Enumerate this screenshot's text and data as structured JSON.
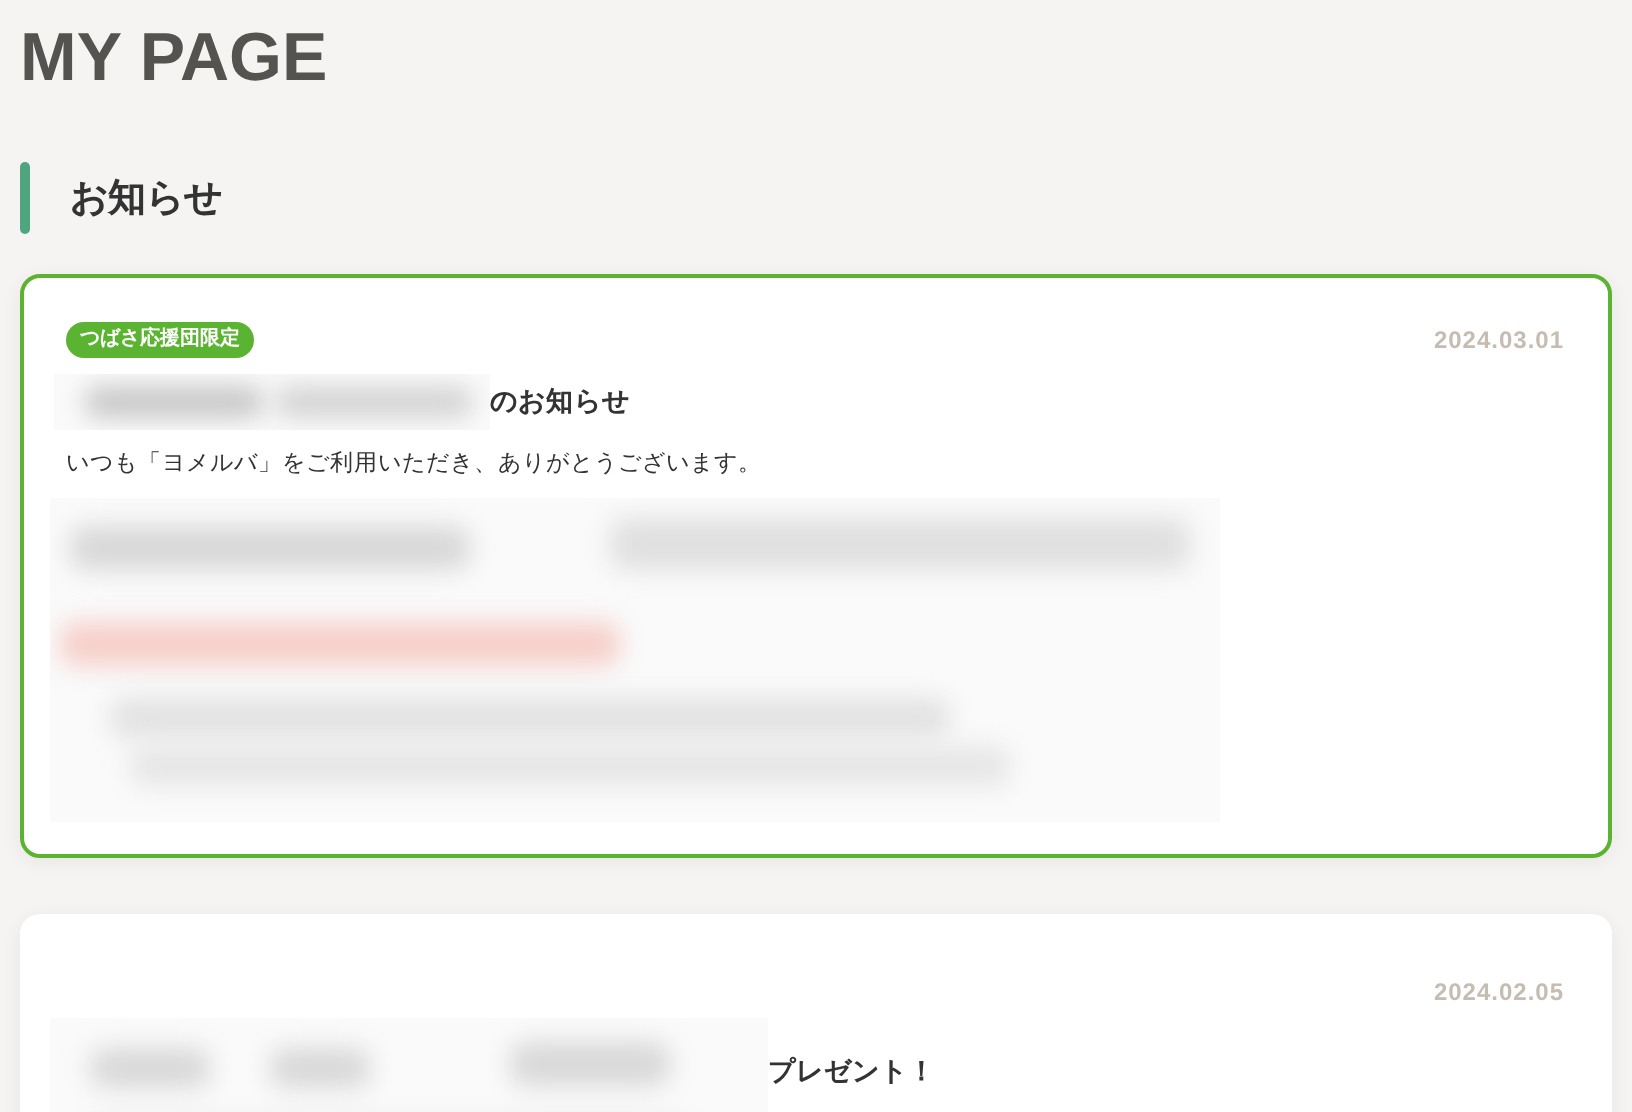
{
  "page_title": "MY PAGE",
  "section": {
    "heading": "お知らせ"
  },
  "notices": [
    {
      "highlighted": true,
      "badge": "つばさ応援団限定",
      "date": "2024.03.01",
      "title": "のお知らせ",
      "body": "いつも「ヨメルバ」をご利用いただき、ありがとうございます。"
    },
    {
      "highlighted": false,
      "date": "2024.02.05",
      "title": "プレゼント！"
    }
  ]
}
